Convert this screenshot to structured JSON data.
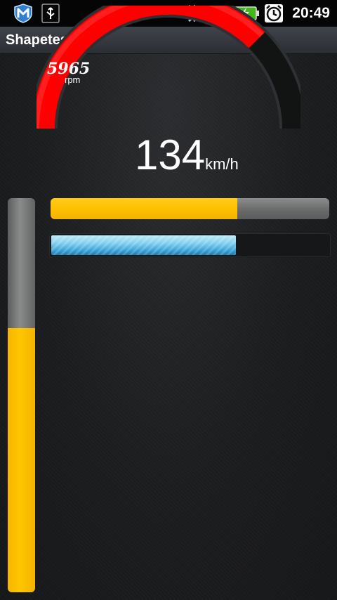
{
  "status_bar": {
    "time": "20:49",
    "icons": [
      "motorola-m-icon",
      "usb-icon",
      "data-sync-icon",
      "signal-icon",
      "battery-charging-icon",
      "alarm-clock-icon"
    ]
  },
  "app": {
    "title": "Shapetest"
  },
  "gauge": {
    "rpm_value": "5965",
    "rpm_unit": "rpm",
    "rpm_fraction": 0.75,
    "speed_value": "134",
    "speed_unit": "km/h",
    "arc_color": "#ff0000",
    "track_color": "#111412"
  },
  "bars": {
    "vertical_yellow_fraction": 0.67,
    "horizontal_yellow_fraction": 0.67,
    "horizontal_blue_fraction": 0.67
  },
  "colors": {
    "accent_yellow": "#ffc400",
    "accent_blue": "#5cbbe8",
    "gauge_red": "#ff0000"
  }
}
